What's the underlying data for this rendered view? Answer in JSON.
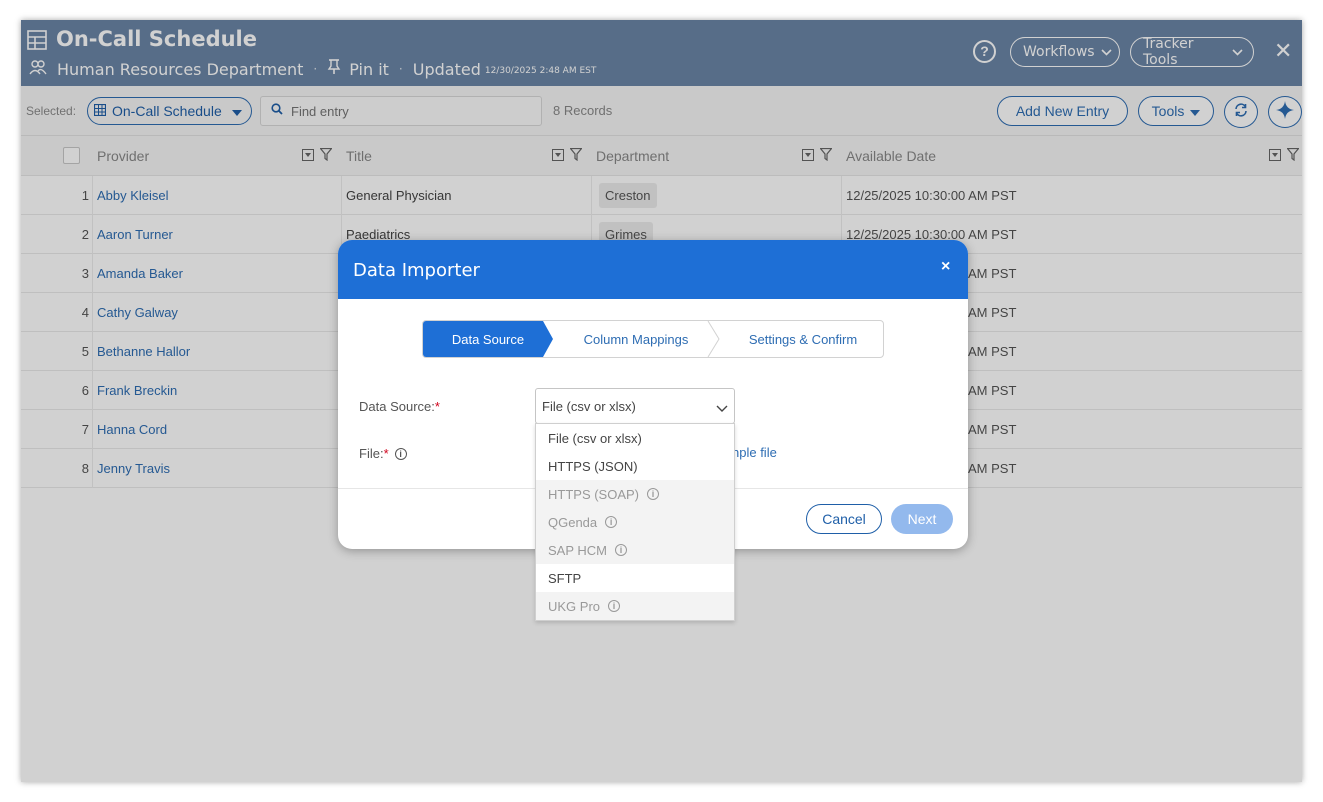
{
  "header": {
    "title": "On-Call Schedule",
    "department": "Human Resources Department",
    "pin_label": "Pin it",
    "updated_label": "Updated",
    "updated_time": "12/30/2025 2:48 AM EST",
    "help": "?",
    "workflows": "Workflows",
    "tracker_tools": "Tracker Tools",
    "close": "✕"
  },
  "toolbar": {
    "selected_label": "Selected:",
    "selected_value": "On-Call Schedule",
    "search_placeholder": "Find entry",
    "records": "8 Records",
    "add_new": "Add New Entry",
    "tools": "Tools"
  },
  "grid": {
    "columns": [
      "Provider",
      "Title",
      "Department",
      "Available Date"
    ],
    "rows": [
      {
        "num": "1",
        "provider": "Abby Kleisel",
        "title": "General Physician",
        "department": "Creston",
        "date": "12/25/2025 10:30:00 AM PST"
      },
      {
        "num": "2",
        "provider": "Aaron Turner",
        "title": "Paediatrics",
        "department": "Grimes",
        "date": "12/25/2025 10:30:00 AM PST"
      },
      {
        "num": "3",
        "provider": "Amanda Baker",
        "title": "",
        "department": "",
        "date": "AM PST"
      },
      {
        "num": "4",
        "provider": "Cathy Galway",
        "title": "",
        "department": "",
        "date": "AM PST"
      },
      {
        "num": "5",
        "provider": "Bethanne Hallor",
        "title": "",
        "department": "",
        "date": "AM PST"
      },
      {
        "num": "6",
        "provider": "Frank Breckin",
        "title": "",
        "department": "",
        "date": "AM PST"
      },
      {
        "num": "7",
        "provider": "Hanna Cord",
        "title": "",
        "department": "",
        "date": "AM PST"
      },
      {
        "num": "8",
        "provider": "Jenny Travis",
        "title": "",
        "department": "",
        "date": "AM PST"
      }
    ]
  },
  "modal": {
    "title": "Data Importer",
    "close": "×",
    "steps": [
      "Data Source",
      "Column Mappings",
      "Settings & Confirm"
    ],
    "data_source_label": "Data Source:",
    "file_label": "File:",
    "required_mark": "*",
    "selected_source": "File (csv or xlsx)",
    "sample_link": "nple file",
    "cancel": "Cancel",
    "next": "Next",
    "options": [
      {
        "label": "File (csv or xlsx)",
        "enabled": true,
        "info": false
      },
      {
        "label": "HTTPS (JSON)",
        "enabled": true,
        "info": false
      },
      {
        "label": "HTTPS (SOAP)",
        "enabled": false,
        "info": true
      },
      {
        "label": "QGenda",
        "enabled": false,
        "info": true
      },
      {
        "label": "SAP HCM",
        "enabled": false,
        "info": true
      },
      {
        "label": "SFTP",
        "enabled": true,
        "info": false
      },
      {
        "label": "UKG Pro",
        "enabled": false,
        "info": true
      }
    ]
  },
  "colors": {
    "header_bg": "#6b86a7",
    "modal_header": "#1e6fd6",
    "link": "#2e6db3",
    "next_disabled": "#93b9ed"
  }
}
